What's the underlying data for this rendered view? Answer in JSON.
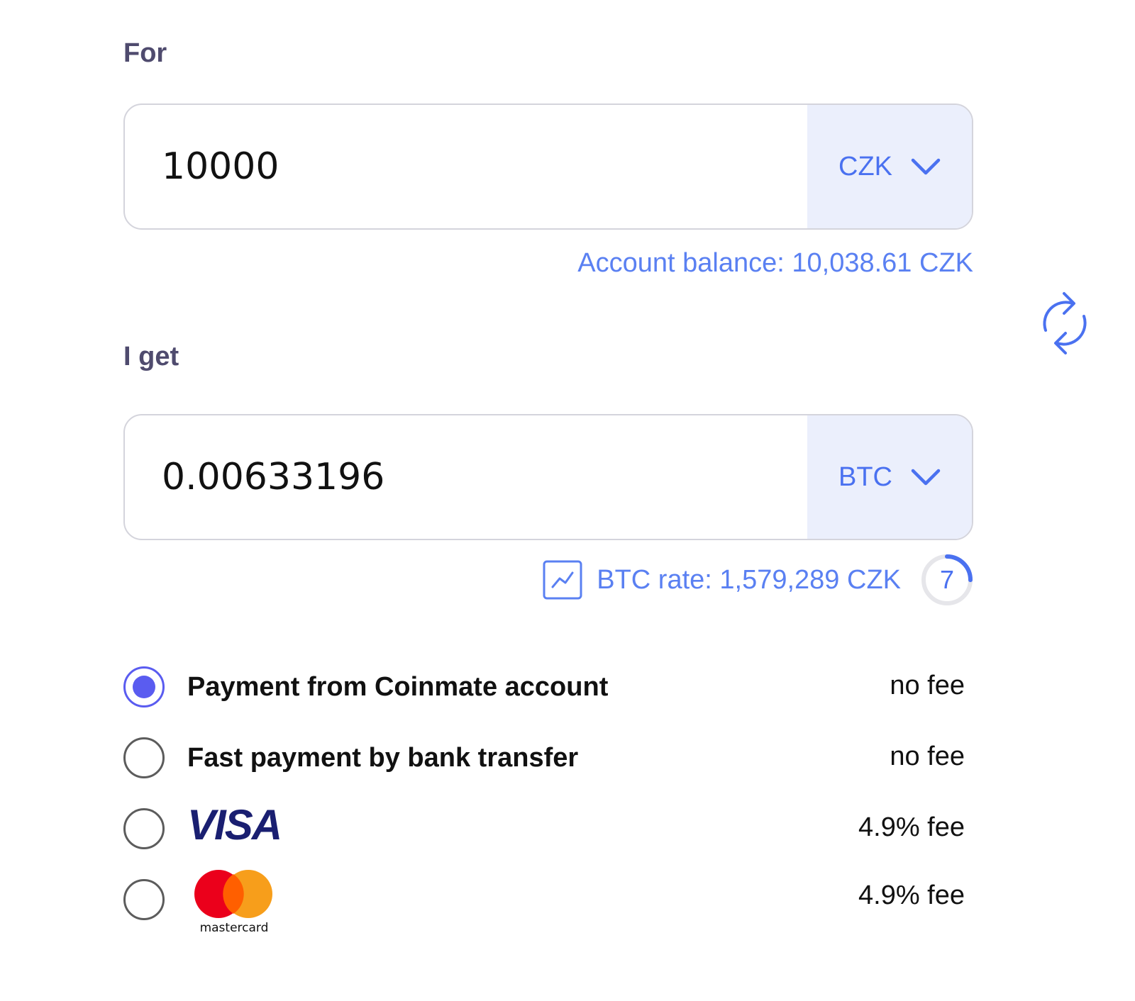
{
  "from": {
    "label": "For",
    "amount": "10000",
    "currency": "CZK",
    "balance_text": "Account balance: 10,038.61 CZK"
  },
  "to": {
    "label": "I get",
    "amount": "0.00633196",
    "currency": "BTC",
    "rate_text": "BTC rate: 1,579,289 CZK",
    "refresh_countdown": "7",
    "refresh_progress": 0.25
  },
  "payment_methods": [
    {
      "label": "Payment from Coinmate account",
      "fee": "no fee",
      "selected": true
    },
    {
      "label": "Fast payment by bank transfer",
      "fee": "no fee",
      "selected": false
    },
    {
      "label": "VISA",
      "fee": "4.9% fee",
      "selected": false
    },
    {
      "label": "mastercard",
      "fee": "4.9% fee",
      "selected": false
    }
  ],
  "icons": {
    "swap": "swap-arrows-icon",
    "chart": "chart-line-icon",
    "chevron": "chevron-down-icon"
  },
  "colors": {
    "accent": "#4a71f0",
    "link": "#5a80f2",
    "currency_bg": "#ebeffc",
    "radio_selected": "#5a5cf0",
    "label": "#4f4b6e",
    "visa": "#1a1f71",
    "mc_red": "#eb001b",
    "mc_orange": "#f79e1b"
  }
}
